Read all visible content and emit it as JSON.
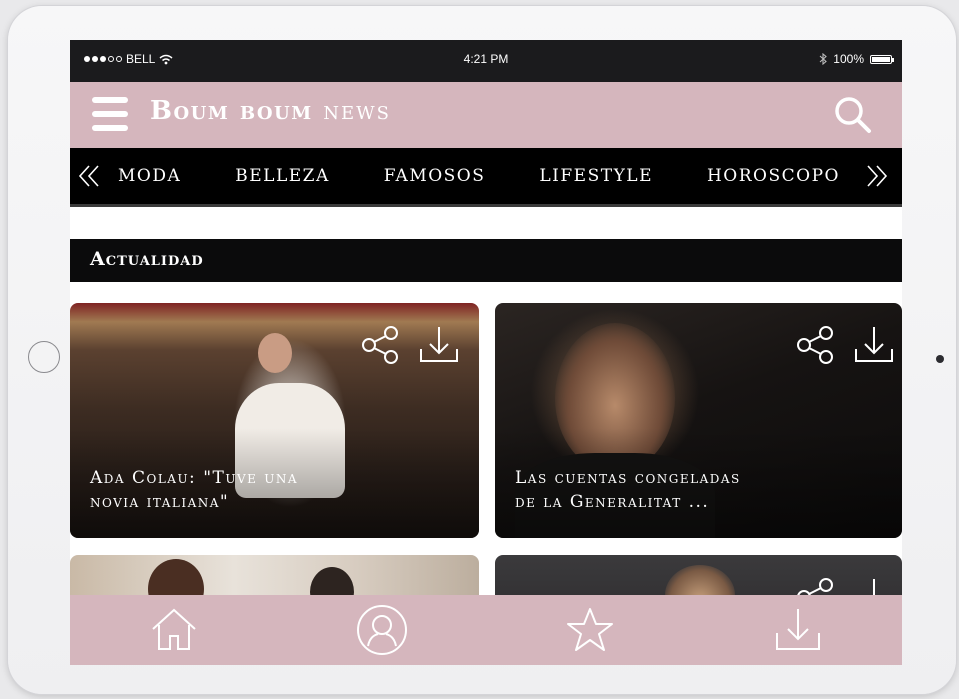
{
  "status_bar": {
    "carrier": "BELL",
    "time": "4:21 PM",
    "battery": "100%",
    "icons": [
      "signal-dots-icon",
      "wifi-icon",
      "bluetooth-icon",
      "battery-icon"
    ]
  },
  "header": {
    "brand_bold": "Boum boum",
    "brand_light": "news",
    "menu_icon": "hamburger-icon",
    "search_icon": "search-icon",
    "background": "#d5b6bd"
  },
  "categories": {
    "items": [
      "MODA",
      "BELLEZA",
      "FAMOSOS",
      "LIFESTYLE",
      "HOROSCOPO"
    ],
    "prev_icon": "double-chevron-left-icon",
    "next_icon": "double-chevron-right-icon"
  },
  "section": {
    "title": "Actualidad"
  },
  "articles": [
    {
      "headline_line1": "Ada Colau: \"Tuve una",
      "headline_line2": "novia italiana\""
    },
    {
      "headline_line1": "Las cuentas congeladas",
      "headline_line2": "de la Generalitat ..."
    }
  ],
  "tab_bar": {
    "items": [
      "home-icon",
      "profile-icon",
      "star-icon",
      "download-icon"
    ]
  }
}
